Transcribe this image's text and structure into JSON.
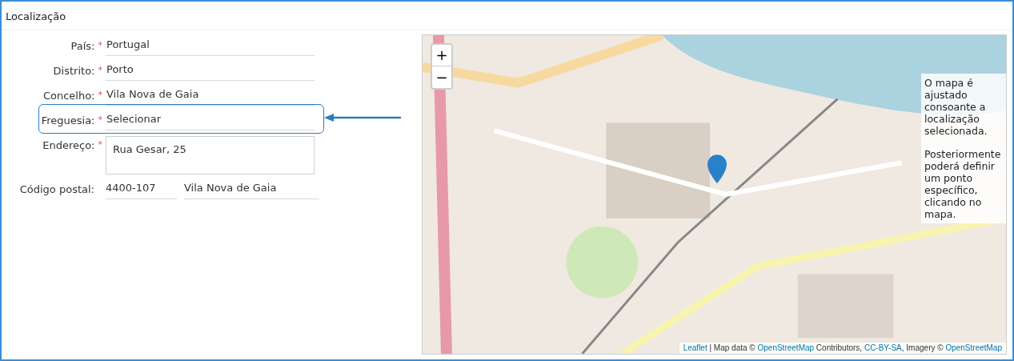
{
  "section": {
    "title": "Localização"
  },
  "fields": [
    {
      "kind": "line",
      "label": "País:",
      "required_mark": "*",
      "values": [
        "Portugal"
      ],
      "highlighted": false
    },
    {
      "kind": "line",
      "label": "Distrito:",
      "required_mark": "*",
      "values": [
        "Porto"
      ],
      "highlighted": false
    },
    {
      "kind": "line",
      "label": "Concelho:",
      "required_mark": "*",
      "values": [
        "Vila Nova de Gaia"
      ],
      "highlighted": false
    },
    {
      "kind": "line",
      "label": "Freguesia:",
      "required_mark": "*",
      "values": [
        "Selecionar"
      ],
      "highlighted": true
    },
    {
      "kind": "textarea",
      "label": "Endereço:",
      "required_mark": "*",
      "values": [
        "Rua Gesar, 25"
      ],
      "highlighted": false
    },
    {
      "kind": "split",
      "label": "Código postal:",
      "values": [
        "4400-107",
        "Vila Nova de Gaia"
      ],
      "highlighted": false
    }
  ],
  "map": {
    "zoom_in": "+",
    "zoom_out": "−",
    "note": [
      "O mapa é ajustado consoante a localização selecionada.",
      "Posteriormente poderá definir um ponto específico, clicando no mapa."
    ],
    "attribution": [
      {
        "kind": "link",
        "text": "Leaflet"
      },
      {
        "kind": "text",
        "text": " | Map data © "
      },
      {
        "kind": "link",
        "text": "OpenStreetMap"
      },
      {
        "kind": "text",
        "text": " Contributors, "
      },
      {
        "kind": "link",
        "text": "CC-BY-SA"
      },
      {
        "kind": "text",
        "text": ", Imagery © "
      },
      {
        "kind": "link",
        "text": "OpenStreetMap"
      }
    ]
  }
}
